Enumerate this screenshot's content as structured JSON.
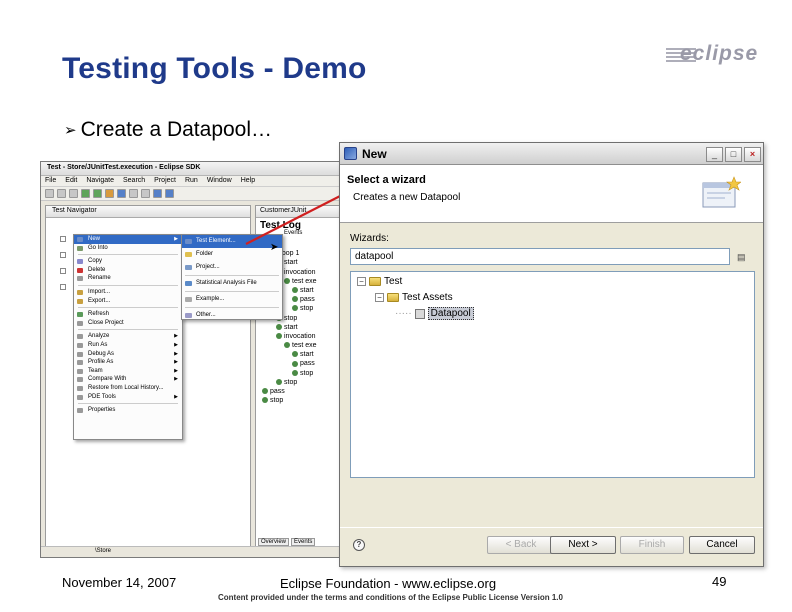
{
  "slide": {
    "title": "Testing Tools - Demo",
    "logo_text": "eclipse",
    "bullet": "Create a Datapool…"
  },
  "eclipse_window": {
    "title": "Test - Store/JUnitTest.execution - Eclipse SDK",
    "menu": [
      "File",
      "Edit",
      "Navigate",
      "Search",
      "Project",
      "Run",
      "Window",
      "Help"
    ],
    "navigator_tab": "Test Navigator",
    "editor_tab": "CustomerJUnit",
    "editor_header": "Test Log",
    "editor_subheader": "Events",
    "log_items": [
      "start",
      "Loop 1",
      "start",
      "invocation",
      "test exe",
      "start",
      "pass",
      "stop",
      "stop",
      "start",
      "invocation",
      "test exe",
      "start",
      "pass",
      "stop",
      "stop",
      "pass",
      "stop"
    ],
    "bottom_tabs": [
      "Overview",
      "Events"
    ],
    "status_text": "\\Store"
  },
  "context_menu": {
    "items": [
      {
        "label": "New",
        "submenu": true,
        "selected": true
      },
      {
        "label": "Go Into"
      },
      {
        "label": "Copy"
      },
      {
        "label": "Delete"
      },
      {
        "label": "Rename"
      },
      {
        "label": "Import..."
      },
      {
        "label": "Export..."
      },
      {
        "label": "Refresh"
      },
      {
        "label": "Close Project"
      },
      {
        "label": "Analyze",
        "submenu": true
      },
      {
        "label": "Run As",
        "submenu": true
      },
      {
        "label": "Debug As",
        "submenu": true
      },
      {
        "label": "Profile As",
        "submenu": true
      },
      {
        "label": "Team",
        "submenu": true
      },
      {
        "label": "Compare With",
        "submenu": true
      },
      {
        "label": "Restore from Local History...",
        "submenu": false
      },
      {
        "label": "PDE Tools",
        "submenu": true
      },
      {
        "label": "Properties"
      }
    ],
    "new_submenu": [
      {
        "label": "Test Element...",
        "selected": true
      },
      {
        "label": "Folder"
      },
      {
        "label": "Project..."
      },
      {
        "label": "Statistical Analysis File"
      },
      {
        "label": "Example..."
      },
      {
        "label": "Other..."
      }
    ]
  },
  "wizard": {
    "window_title": "New",
    "heading": "Select a wizard",
    "description": "Creates a new Datapool",
    "wizards_label": "Wizards:",
    "filter_value": "datapool",
    "tree": [
      {
        "label": "Test",
        "level": 0
      },
      {
        "label": "Test Assets",
        "level": 1
      },
      {
        "label": "Datapool",
        "level": 2,
        "selected": true
      }
    ],
    "buttons": {
      "back": "< Back",
      "next": "Next >",
      "finish": "Finish",
      "cancel": "Cancel"
    },
    "controls": {
      "minimize": "_",
      "maximize": "□",
      "close": "×"
    }
  },
  "footer": {
    "date": "November 14, 2007",
    "org": "Eclipse Foundation - www.eclipse.org",
    "license": "Content provided under the terms and conditions of the Eclipse Public License Version 1.0",
    "page": "49"
  },
  "colors": {
    "title": "#1f3a8a",
    "selection": "#316ac5",
    "arrow": "#d02020"
  }
}
